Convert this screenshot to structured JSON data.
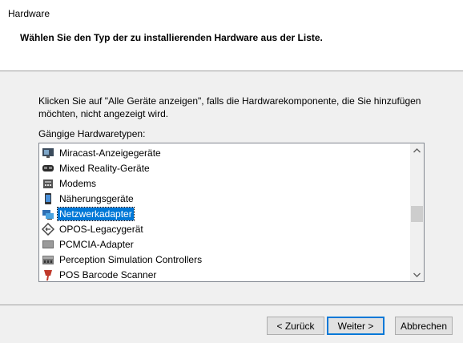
{
  "header": {
    "title": "Hardware",
    "subtitle": "Wählen Sie den Typ der zu installierenden Hardware aus der Liste."
  },
  "instructions": "Klicken Sie auf \"Alle Geräte anzeigen\", falls die Hardwarekomponente, die Sie hinzufügen möchten, nicht angezeigt wird.",
  "list_label": "Gängige Hardwaretypen:",
  "list": {
    "items": [
      {
        "label": "Miracast-Anzeigegeräte",
        "icon": "display-icon"
      },
      {
        "label": "Mixed Reality-Geräte",
        "icon": "headset-icon"
      },
      {
        "label": "Modems",
        "icon": "modem-icon"
      },
      {
        "label": "Näherungsgeräte",
        "icon": "phone-icon"
      },
      {
        "label": "Netzwerkadapter",
        "icon": "network-adapter-icon",
        "selected": true
      },
      {
        "label": "OPOS-Legacygerät",
        "icon": "diamond-arrow-icon"
      },
      {
        "label": "PCMCIA-Adapter",
        "icon": "card-icon"
      },
      {
        "label": "Perception Simulation Controllers",
        "icon": "controller-icon"
      },
      {
        "label": "POS Barcode Scanner",
        "icon": "barcode-scanner-icon"
      }
    ],
    "selected_color": "#0078d7"
  },
  "buttons": {
    "back": "< Zurück",
    "next": "Weiter >",
    "cancel": "Abbrechen"
  }
}
